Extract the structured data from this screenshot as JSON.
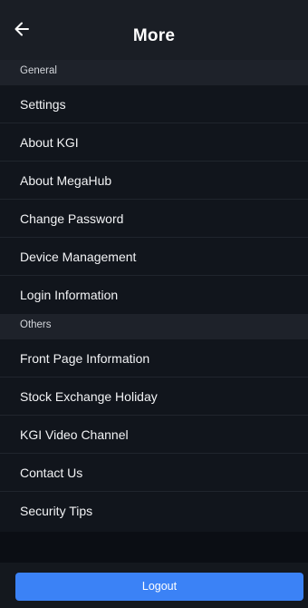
{
  "header": {
    "title": "More",
    "back_icon": "arrow-left-icon"
  },
  "sections": [
    {
      "title": "General",
      "items": [
        "Settings",
        "About KGI",
        "About MegaHub",
        "Change Password",
        "Device Management",
        "Login Information"
      ]
    },
    {
      "title": "Others",
      "items": [
        "Front Page Information",
        "Stock Exchange Holiday",
        "KGI Video Channel",
        "Contact Us",
        "Security Tips"
      ]
    }
  ],
  "footer": {
    "logout_label": "Logout"
  },
  "colors": {
    "background": "#0e1219",
    "header": "#1a1e25",
    "section_header": "#1e222a",
    "accent": "#3b82f6"
  }
}
